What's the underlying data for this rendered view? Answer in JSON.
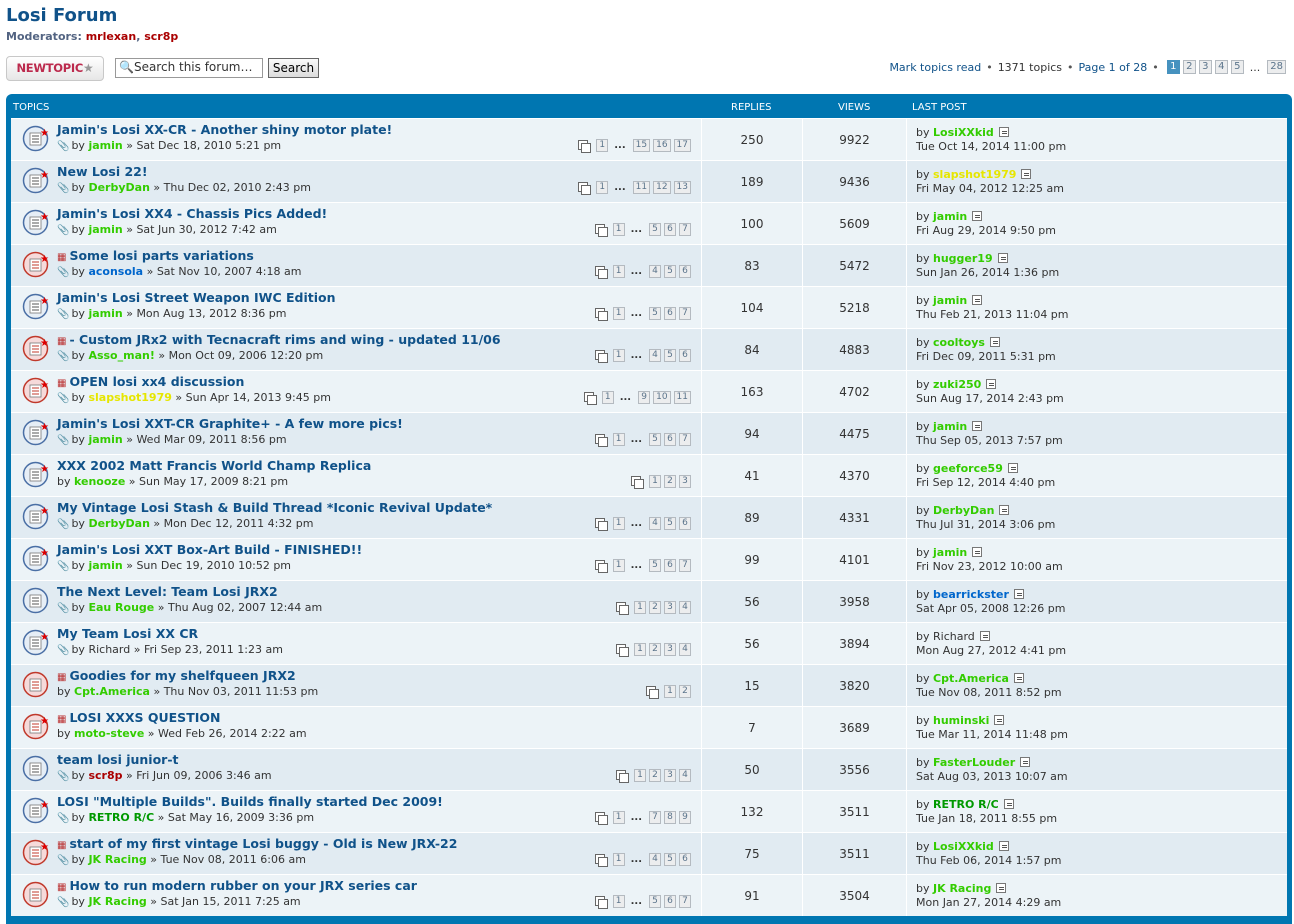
{
  "forum": {
    "title": "Losi Forum",
    "moderators_label": "Moderators:",
    "moderators": [
      "mrlexan",
      "scr8p"
    ]
  },
  "actions": {
    "newtopic_label": "NEWTOPIC",
    "search_placeholder": "Search this forum…",
    "search_button": "Search",
    "mark_read": "Mark topics read",
    "topic_count": "1371 topics",
    "page_of": "Page 1 of 28",
    "pages": [
      "1",
      "2",
      "3",
      "4",
      "5"
    ],
    "last_page": "28",
    "ellipsis": "..."
  },
  "table_headers": {
    "topics": "TOPICS",
    "replies": "REPLIES",
    "views": "VIEWS",
    "last_post": "LAST POST"
  },
  "topics": [
    {
      "title": "Jamin's Losi XX-CR - Another shiny motor plate!",
      "by": "by",
      "author": "jamin",
      "date": "» Sat Dec 18, 2010 5:21 pm",
      "pages": [
        "1",
        "15",
        "16",
        "17"
      ],
      "replies": "250",
      "views": "9922",
      "last_user": "LosiXXkid",
      "last_date": "Tue Oct 14, 2014 11:00 pm"
    },
    {
      "title": "New Losi 22!",
      "by": "by",
      "author": "DerbyDan",
      "date": "» Thu Dec 02, 2010 2:43 pm",
      "pages": [
        "1",
        "11",
        "12",
        "13"
      ],
      "replies": "189",
      "views": "9436",
      "last_user": "slapshot1979",
      "last_date": "Fri May 04, 2012 12:25 am"
    },
    {
      "title": "Jamin's Losi XX4 - Chassis Pics Added!",
      "by": "by",
      "author": "jamin",
      "date": "» Sat Jun 30, 2012 7:42 am",
      "pages": [
        "1",
        "5",
        "6",
        "7"
      ],
      "replies": "100",
      "views": "5609",
      "last_user": "jamin",
      "last_date": "Fri Aug 29, 2014 9:50 pm"
    },
    {
      "title": "Some losi parts variations",
      "by": "by",
      "author": "aconsola",
      "date": "» Sat Nov 10, 2007 4:18 am",
      "pages": [
        "1",
        "4",
        "5",
        "6"
      ],
      "replies": "83",
      "views": "5472",
      "last_user": "hugger19",
      "last_date": "Sun Jan 26, 2014 1:36 pm"
    },
    {
      "title": "Jamin's Losi Street Weapon IWC Edition",
      "by": "by",
      "author": "jamin",
      "date": "» Mon Aug 13, 2012 8:36 pm",
      "pages": [
        "1",
        "5",
        "6",
        "7"
      ],
      "replies": "104",
      "views": "5218",
      "last_user": "jamin",
      "last_date": "Thu Feb 21, 2013 11:04 pm"
    },
    {
      "title": "- Custom JRx2 with Tecnacraft rims and wing - updated 11/06",
      "by": "by",
      "author": "Asso_man!",
      "date": "» Mon Oct 09, 2006 12:20 pm",
      "pages": [
        "1",
        "4",
        "5",
        "6"
      ],
      "replies": "84",
      "views": "4883",
      "last_user": "cooltoys",
      "last_date": "Fri Dec 09, 2011 5:31 pm"
    },
    {
      "title": "OPEN losi xx4 discussion",
      "by": "by",
      "author": "slapshot1979",
      "date": "» Sun Apr 14, 2013 9:45 pm",
      "pages": [
        "1",
        "9",
        "10",
        "11"
      ],
      "replies": "163",
      "views": "4702",
      "last_user": "zuki250",
      "last_date": "Sun Aug 17, 2014 2:43 pm"
    },
    {
      "title": "Jamin's Losi XXT-CR Graphite+ - A few more pics!",
      "by": "by",
      "author": "jamin",
      "date": "» Wed Mar 09, 2011 8:56 pm",
      "pages": [
        "1",
        "5",
        "6",
        "7"
      ],
      "replies": "94",
      "views": "4475",
      "last_user": "jamin",
      "last_date": "Thu Sep 05, 2013 7:57 pm"
    },
    {
      "title": "XXX 2002 Matt Francis World Champ Replica",
      "by": "by",
      "author": "kenooze",
      "date": "» Sun May 17, 2009 8:21 pm",
      "pages": [
        "1",
        "2",
        "3"
      ],
      "replies": "41",
      "views": "4370",
      "last_user": "geeforce59",
      "last_date": "Fri Sep 12, 2014 4:40 pm"
    },
    {
      "title": "My Vintage Losi Stash & Build Thread *Iconic Revival Update*",
      "by": "by",
      "author": "DerbyDan",
      "date": "» Mon Dec 12, 2011 4:32 pm",
      "pages": [
        "1",
        "4",
        "5",
        "6"
      ],
      "replies": "89",
      "views": "4331",
      "last_user": "DerbyDan",
      "last_date": "Thu Jul 31, 2014 3:06 pm"
    },
    {
      "title": "Jamin's Losi XXT Box-Art Build - FINISHED!!",
      "by": "by",
      "author": "jamin",
      "date": "» Sun Dec 19, 2010 10:52 pm",
      "pages": [
        "1",
        "5",
        "6",
        "7"
      ],
      "replies": "99",
      "views": "4101",
      "last_user": "jamin",
      "last_date": "Fri Nov 23, 2012 10:00 am"
    },
    {
      "title": "The Next Level: Team Losi JRX2",
      "by": "by",
      "author": "Eau Rouge",
      "date": "» Thu Aug 02, 2007 12:44 am",
      "pages": [
        "1",
        "2",
        "3",
        "4"
      ],
      "replies": "56",
      "views": "3958",
      "last_user": "bearrickster",
      "last_date": "Sat Apr 05, 2008 12:26 pm"
    },
    {
      "title": "My Team Losi XX CR",
      "by": "by",
      "author": "Richard",
      "date": "» Fri Sep 23, 2011 1:23 am",
      "pages": [
        "1",
        "2",
        "3",
        "4"
      ],
      "replies": "56",
      "views": "3894",
      "last_user": "Richard",
      "last_date": "Mon Aug 27, 2012 4:41 pm"
    },
    {
      "title": "Goodies for my shelfqueen JRX2",
      "by": "by",
      "author": "Cpt.America",
      "date": "» Thu Nov 03, 2011 11:53 pm",
      "pages": [
        "1",
        "2"
      ],
      "replies": "15",
      "views": "3820",
      "last_user": "Cpt.America",
      "last_date": "Tue Nov 08, 2011 8:52 pm"
    },
    {
      "title": "LOSI XXXS QUESTION",
      "by": "by",
      "author": "moto-steve",
      "date": "» Wed Feb 26, 2014 2:22 am",
      "pages": [],
      "replies": "7",
      "views": "3689",
      "last_user": "huminski",
      "last_date": "Tue Mar 11, 2014 11:48 pm"
    },
    {
      "title": "team losi junior-t",
      "by": "by",
      "author": "scr8p",
      "date": "» Fri Jun 09, 2006 3:46 am",
      "pages": [
        "1",
        "2",
        "3",
        "4"
      ],
      "replies": "50",
      "views": "3556",
      "last_user": "FasterLouder",
      "last_date": "Sat Aug 03, 2013 10:07 am"
    },
    {
      "title": "LOSI \"Multiple Builds\". Builds finally started Dec 2009!",
      "by": "by",
      "author": "RETRO R/C",
      "date": "» Sat May 16, 2009 3:36 pm",
      "pages": [
        "1",
        "7",
        "8",
        "9"
      ],
      "replies": "132",
      "views": "3511",
      "last_user": "RETRO R/C",
      "last_date": "Tue Jan 18, 2011 8:55 pm"
    },
    {
      "title": "start of my first vintage Losi buggy - Old is New JRX-22",
      "by": "by",
      "author": "JK Racing",
      "date": "» Tue Nov 08, 2011 6:06 am",
      "pages": [
        "1",
        "4",
        "5",
        "6"
      ],
      "replies": "75",
      "views": "3511",
      "last_user": "LosiXXkid",
      "last_date": "Thu Feb 06, 2014 1:57 pm"
    },
    {
      "title": "How to run modern rubber on your JRX series car",
      "by": "by",
      "author": "JK Racing",
      "date": "» Sat Jan 15, 2011 7:25 am",
      "pages": [
        "1",
        "5",
        "6",
        "7"
      ],
      "replies": "91",
      "views": "3504",
      "last_user": "JK Racing",
      "last_date": "Mon Jan 27, 2014 4:29 am"
    }
  ],
  "colors": {
    "header_blue": "#0076b1",
    "link": "#105289",
    "user_green": "#33cc00",
    "user_yellow": "#e6e600",
    "user_blue": "#0066cc",
    "user_red": "#aa0000",
    "row_a": "#ecf3f7",
    "row_b": "#e1ebf2"
  }
}
